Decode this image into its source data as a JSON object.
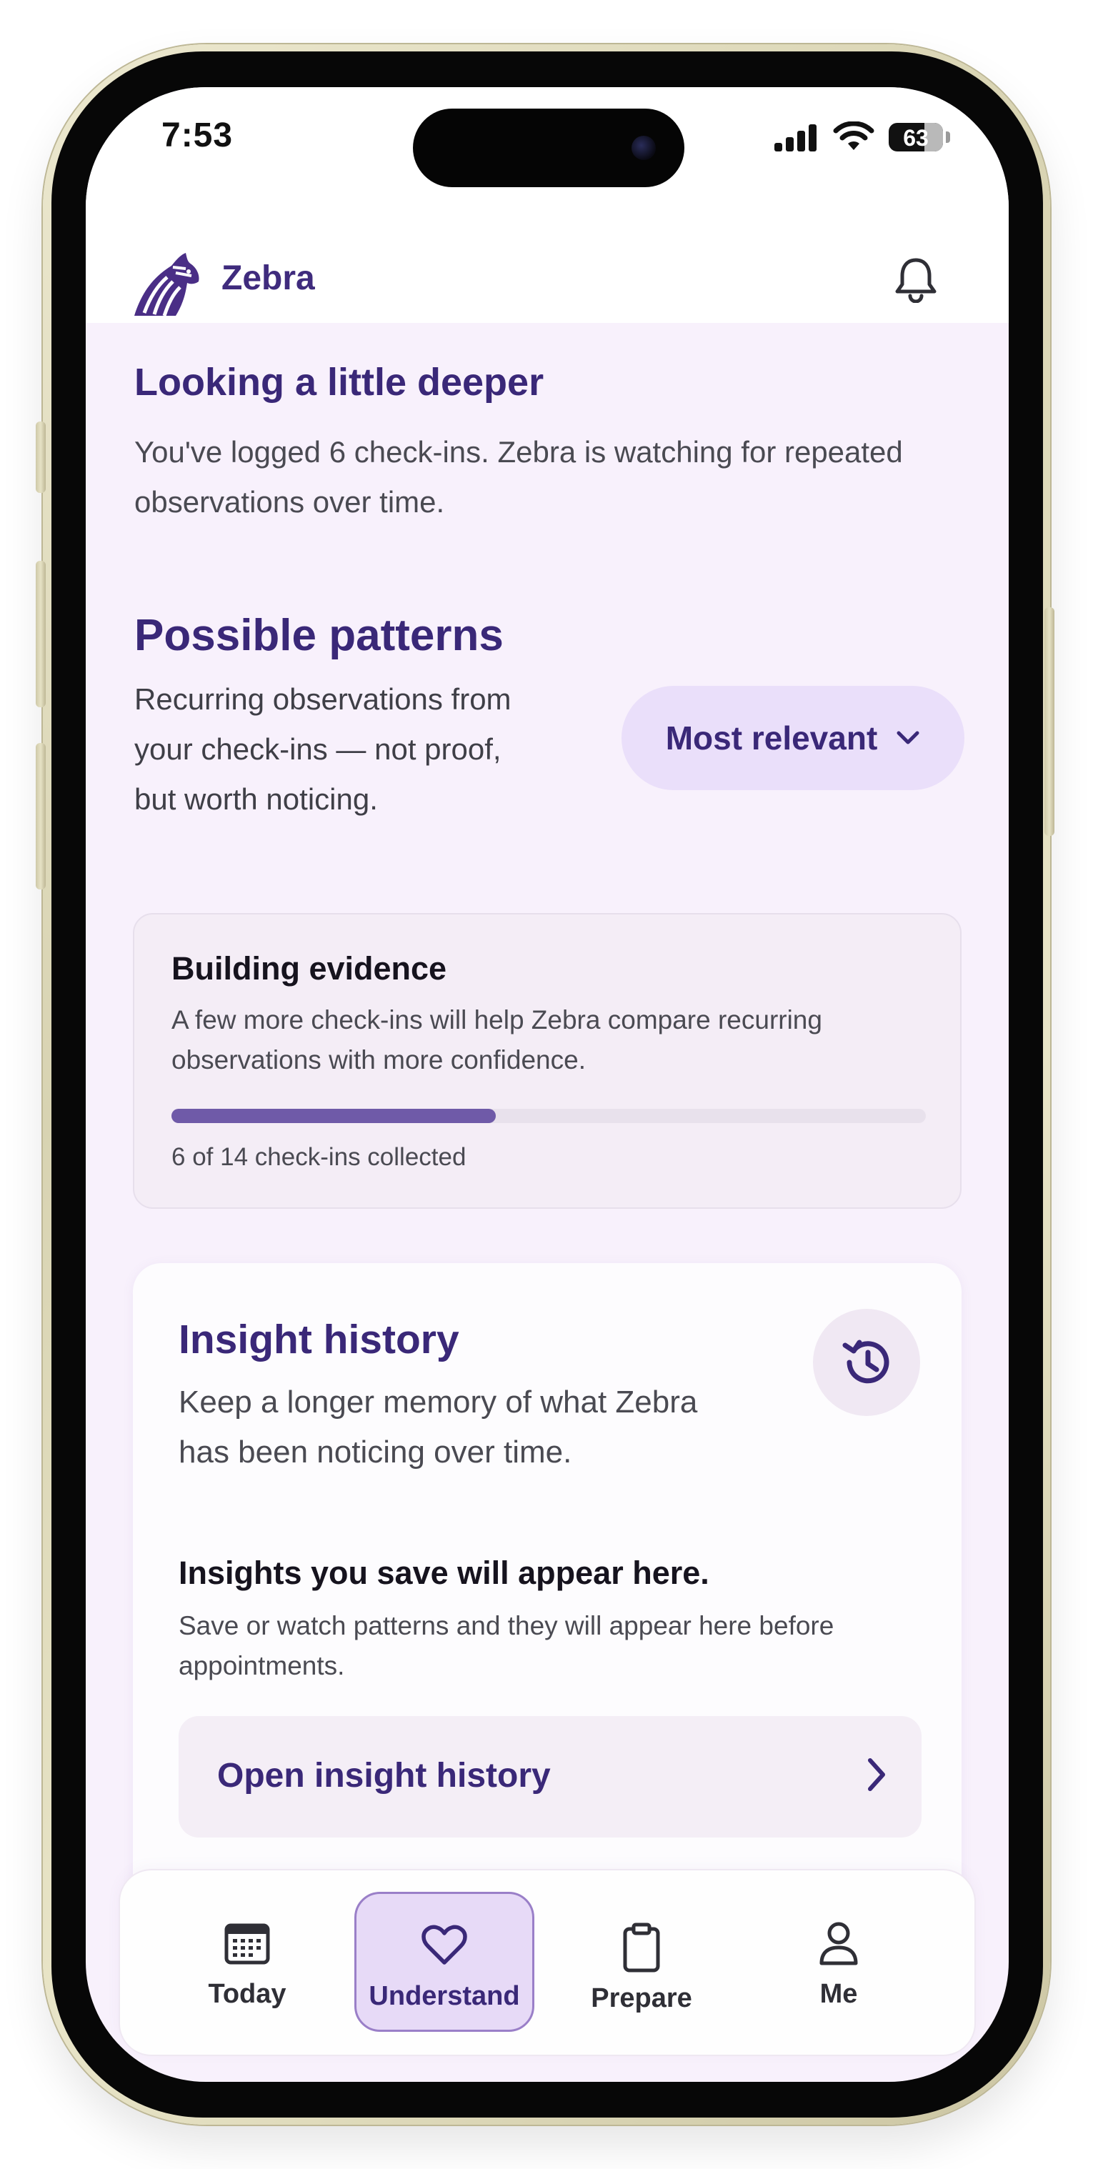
{
  "status_bar": {
    "time": "7:53",
    "battery_level": "63"
  },
  "header": {
    "brand": "Zebra",
    "logo_icon": "zebra-logo",
    "notifications_icon": "bell-icon"
  },
  "intro": {
    "title": "Looking a little deeper",
    "text": "You've logged 6 check-ins. Zebra is watching for repeated observations over time."
  },
  "patterns": {
    "title": "Possible patterns",
    "subtitle": "Recurring observations from your check-ins — not proof, but worth noticing.",
    "sort": {
      "selected": "Most relevant",
      "icon": "chevron-down-icon"
    }
  },
  "evidence": {
    "title": "Building evidence",
    "text": "A few more check-ins will help Zebra compare recurring observations with more confidence.",
    "progress_text": "6 of 14 check-ins collected",
    "progress_fraction": 0.43
  },
  "history": {
    "title": "Insight history",
    "text": "Keep a longer memory of what Zebra has been noticing over time.",
    "icon": "history-icon",
    "empty_title": "Insights you save will appear here.",
    "empty_text": "Save or watch patterns and they will appear here before appointments.",
    "open_label": "Open insight history",
    "open_icon": "chevron-right-icon"
  },
  "bottom_nav": {
    "items": [
      {
        "label": "Today",
        "icon": "calendar-icon",
        "active": false
      },
      {
        "label": "Understand",
        "icon": "heart-icon",
        "active": true
      },
      {
        "label": "Prepare",
        "icon": "clipboard-icon",
        "active": false
      },
      {
        "label": "Me",
        "icon": "person-icon",
        "active": false
      }
    ]
  },
  "colors": {
    "accent": "#3a2878",
    "background": "#f8f1fc",
    "progress_fill": "#6f5aa8",
    "active_tab": "#e7daf7"
  }
}
